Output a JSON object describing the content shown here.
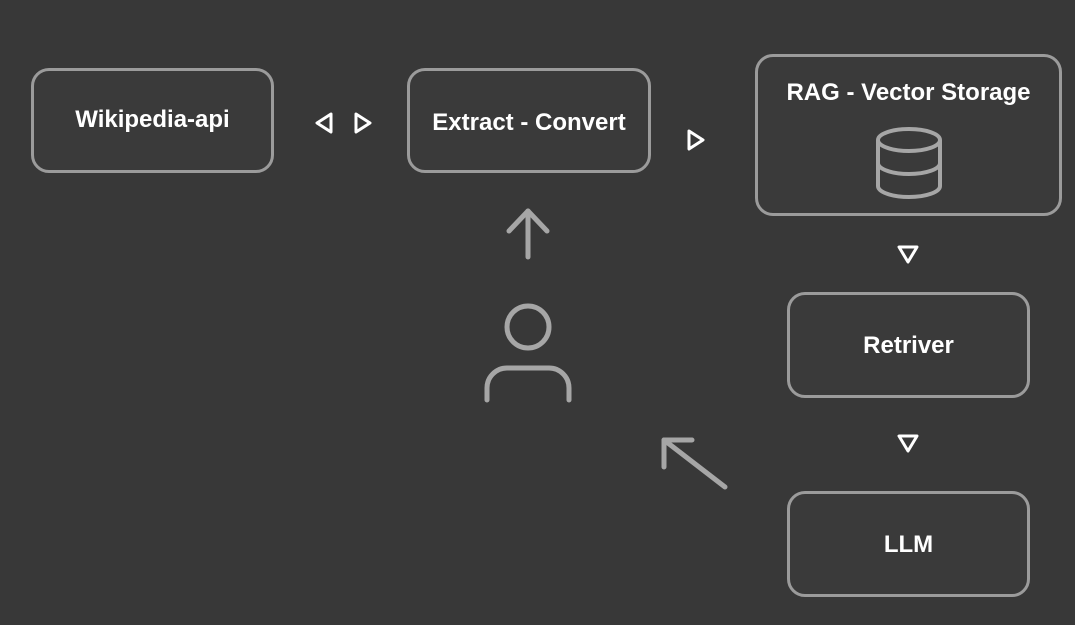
{
  "nodes": {
    "wikipedia": {
      "label": "Wikipedia-api"
    },
    "extract": {
      "label": "Extract - Convert"
    },
    "rag": {
      "label": "RAG - Vector Storage"
    },
    "retriever": {
      "label": "Retriver"
    },
    "llm": {
      "label": "LLM"
    }
  },
  "icons": {
    "storage": "database-icon",
    "user": "user-icon"
  },
  "colors": {
    "background": "#383838",
    "border": "#9b9b9b",
    "text": "#ffffff",
    "icon": "#a6a6a6"
  }
}
